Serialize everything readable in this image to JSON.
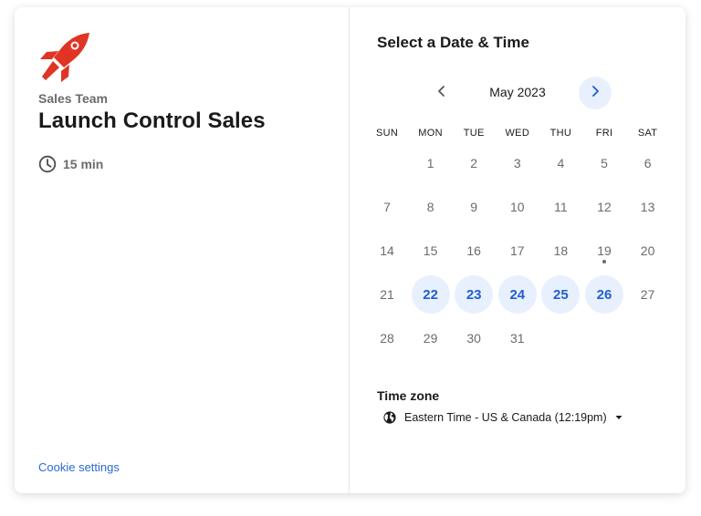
{
  "organizer": {
    "team": "Sales Team",
    "event_title": "Launch Control Sales",
    "duration": "15 min",
    "logo_icon": "rocket-icon",
    "logo_color": "#e03424"
  },
  "footer": {
    "cookie_settings": "Cookie settings"
  },
  "scheduler": {
    "title": "Select a Date & Time",
    "month_label": "May 2023",
    "prev_icon": "chevron-left-icon",
    "next_icon": "chevron-right-icon",
    "weekdays": [
      "SUN",
      "MON",
      "TUE",
      "WED",
      "THU",
      "FRI",
      "SAT"
    ],
    "first_weekday_index": 1,
    "days_in_month": 31,
    "today": 19,
    "available_days": [
      22,
      23,
      24,
      25,
      26
    ],
    "accent_color": "#1f5fd1",
    "available_bg": "#e8f0fd"
  },
  "timezone": {
    "label": "Time zone",
    "value": "Eastern Time - US & Canada (12:19pm)",
    "icon": "globe-icon"
  }
}
